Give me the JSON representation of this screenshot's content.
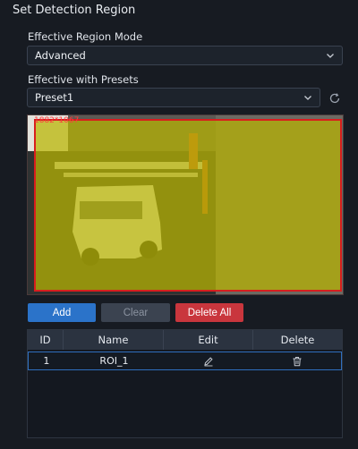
{
  "panel": {
    "title": "Set Detection Region"
  },
  "mode": {
    "label": "Effective Region Mode",
    "value": "Advanced"
  },
  "presets": {
    "label": "Effective with Presets",
    "value": "Preset1"
  },
  "preview": {
    "resolution": "1882*1067"
  },
  "buttons": {
    "add": "Add",
    "clear": "Clear",
    "delete_all": "Delete All"
  },
  "table": {
    "headers": {
      "id": "ID",
      "name": "Name",
      "edit": "Edit",
      "delete": "Delete"
    },
    "rows": [
      {
        "id": "1",
        "name": "ROI_1"
      }
    ]
  },
  "colors": {
    "accent": "#2b73c9",
    "danger": "#c9363d",
    "region_fill": "#bab500",
    "region_border": "#d81e1e"
  },
  "icons": {
    "dropdown": "chevron-down-icon",
    "refresh": "refresh-icon",
    "edit": "pencil-icon",
    "delete": "trash-icon"
  }
}
